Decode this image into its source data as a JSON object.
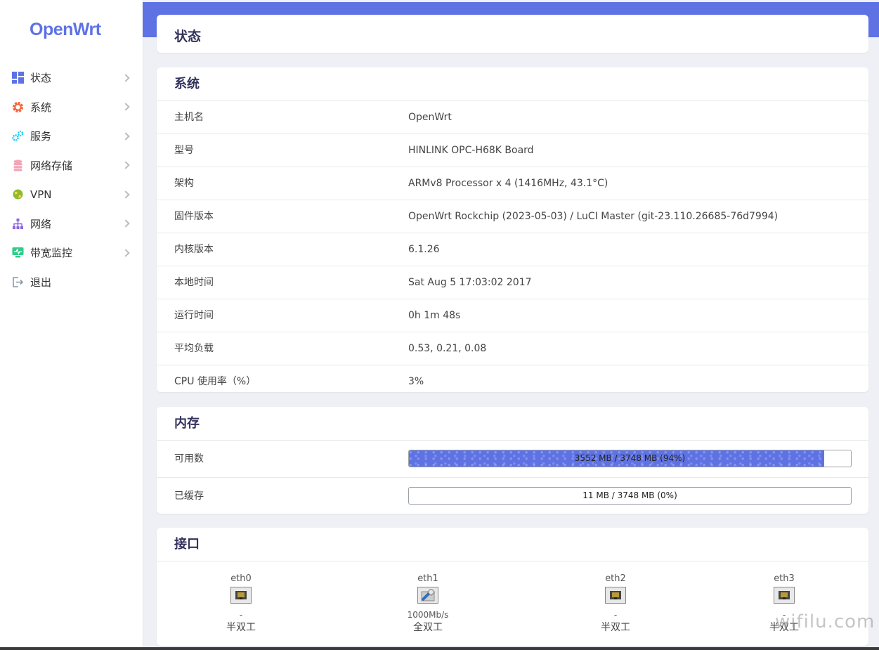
{
  "sidebar": {
    "logo": "OpenWrt",
    "items": [
      {
        "label": "状态",
        "icon": "dashboard-icon",
        "color": "#5e72e4"
      },
      {
        "label": "系统",
        "icon": "gear-icon",
        "color": "#f5653a"
      },
      {
        "label": "服务",
        "icon": "cogs-icon",
        "color": "#11cdef"
      },
      {
        "label": "网络存储",
        "icon": "database-icon",
        "color": "#f3a4b5"
      },
      {
        "label": "VPN",
        "icon": "globe-icon",
        "color": "#8fbc2f"
      },
      {
        "label": "网络",
        "icon": "sitemap-icon",
        "color": "#8965e0"
      },
      {
        "label": "带宽监控",
        "icon": "monitor-icon",
        "color": "#2dce89"
      },
      {
        "label": "退出",
        "icon": "logout-icon",
        "color": "#8898aa"
      }
    ]
  },
  "header": {
    "title": "状态"
  },
  "system": {
    "title": "系统",
    "rows": [
      {
        "key": "主机名",
        "value": "OpenWrt"
      },
      {
        "key": "型号",
        "value": "HINLINK OPC-H68K Board"
      },
      {
        "key": "架构",
        "value": "ARMv8 Processor x 4 (1416MHz, 43.1°C)"
      },
      {
        "key": "固件版本",
        "value": "OpenWrt Rockchip (2023-05-03) / LuCI Master (git-23.110.26685-76d7994)"
      },
      {
        "key": "内核版本",
        "value": "6.1.26"
      },
      {
        "key": "本地时间",
        "value": "Sat Aug 5 17:03:02 2017"
      },
      {
        "key": "运行时间",
        "value": "0h 1m 48s"
      },
      {
        "key": "平均负载",
        "value": "0.53, 0.21, 0.08"
      },
      {
        "key": "CPU 使用率（%）",
        "value": "3%"
      }
    ]
  },
  "memory": {
    "title": "内存",
    "rows": [
      {
        "key": "可用数",
        "text": "3552 MB / 3748 MB (94%)",
        "percent": 94
      },
      {
        "key": "已缓存",
        "text": "11 MB / 3748 MB (0%)",
        "percent": 0
      }
    ]
  },
  "interfaces": {
    "title": "接口",
    "ports": [
      {
        "name": "eth0",
        "speed": "-",
        "duplex": "半双工",
        "connected": false
      },
      {
        "name": "eth1",
        "speed": "1000Mb/s",
        "duplex": "全双工",
        "connected": true
      },
      {
        "name": "eth2",
        "speed": "-",
        "duplex": "半双工",
        "connected": false
      },
      {
        "name": "eth3",
        "speed": "-",
        "duplex": "半双工",
        "connected": false
      }
    ]
  },
  "watermark": "wifilu.com",
  "colors": {
    "accent": "#5e72e4",
    "background": "#eef0f5"
  }
}
